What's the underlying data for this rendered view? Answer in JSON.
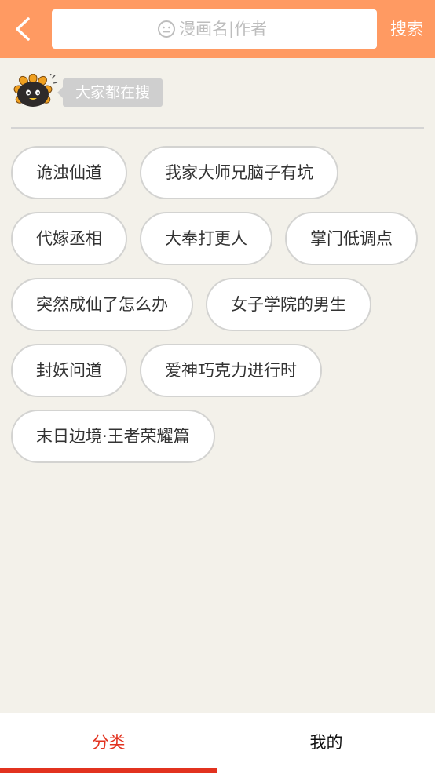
{
  "header": {
    "back_icon": "chevron-left-icon",
    "search_icon": "smiley-search-icon",
    "search_placeholder": "漫画名|作者",
    "search_value": "",
    "search_button_label": "搜索",
    "accent_color": "#ff9a62"
  },
  "hot": {
    "mascot_icon": "sunflower-mascot-icon",
    "label": "大家都在搜"
  },
  "keywords": [
    "诡浊仙道",
    "我家大师兄脑子有坑",
    "代嫁丞相",
    "大奉打更人",
    "掌门低调点",
    "突然成仙了怎么办",
    "女子学院的男生",
    "封妖问道",
    "爱神巧克力进行时",
    "末日边境·王者荣耀篇"
  ],
  "tabbar": {
    "tabs": [
      {
        "label": "分类",
        "active": true
      },
      {
        "label": "我的",
        "active": false
      }
    ],
    "active_color": "#e2321f"
  }
}
